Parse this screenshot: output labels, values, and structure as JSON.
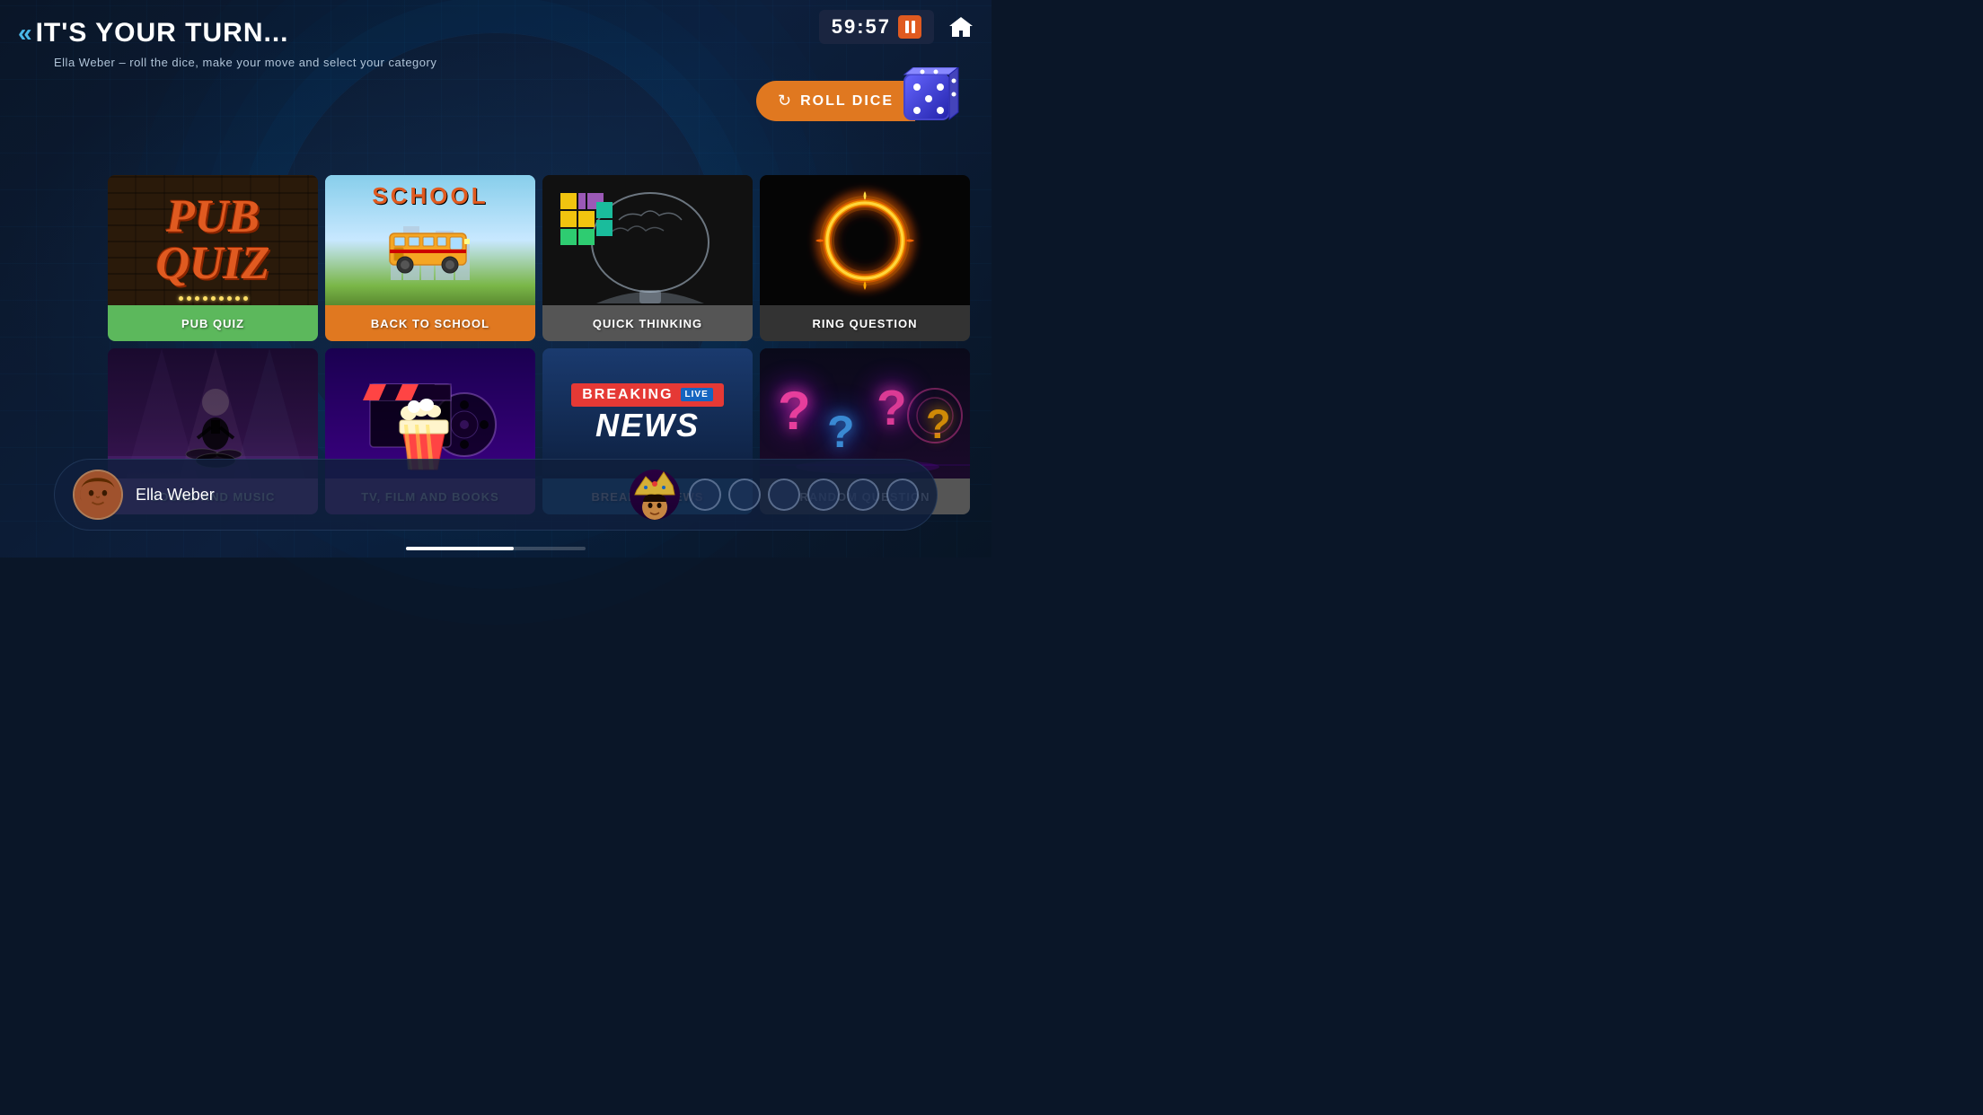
{
  "timer": {
    "display": "59:57"
  },
  "header": {
    "turn_label": "IT'S YOUR TURN...",
    "subtitle": "Ella Weber – roll the dice, make your move and select your category",
    "roll_dice_label": "ROLL DICE"
  },
  "categories": [
    {
      "id": "pub-quiz",
      "label": "PUB QUIZ",
      "label_bg": "#5cb85c",
      "row": 0,
      "col": 0
    },
    {
      "id": "back-to-school",
      "label": "BACK TO SCHOOL",
      "label_bg": "#e07820",
      "row": 0,
      "col": 1
    },
    {
      "id": "quick-thinking",
      "label": "QUICK THINKING",
      "label_bg": "#555555",
      "row": 0,
      "col": 2
    },
    {
      "id": "ring-question",
      "label": "RING QUESTION",
      "label_bg": "#333333",
      "row": 0,
      "col": 3
    },
    {
      "id": "sound-and-music",
      "label": "SOUND AND MUSIC",
      "label_bg": "#9b59b6",
      "row": 1,
      "col": 0
    },
    {
      "id": "tv-film-books",
      "label": "TV, FILM AND BOOKS",
      "label_bg": "#8e44ad",
      "row": 1,
      "col": 1
    },
    {
      "id": "breaking-news",
      "label": "BREAKING NEWS",
      "label_bg": "#2980b9",
      "row": 1,
      "col": 2
    },
    {
      "id": "random-question",
      "label": "RANDOM QUESTION",
      "label_bg": "#555555",
      "row": 1,
      "col": 3
    }
  ],
  "player": {
    "name": "Ella Weber",
    "tokens_total": 6,
    "tokens_filled": 0
  }
}
